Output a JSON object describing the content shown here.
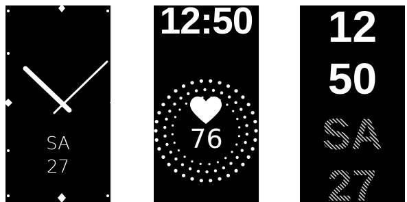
{
  "screens": [
    {
      "style": "analog",
      "day": "SA",
      "date": "27",
      "hour": 12,
      "minute": 50
    },
    {
      "style": "heart-rate",
      "time": "12:50",
      "heart_rate": "76",
      "heart_icon": "heart-icon"
    },
    {
      "style": "stacked-digital",
      "hour": "12",
      "minute": "50",
      "day": "SA",
      "date": "27"
    }
  ],
  "colors": {
    "background": "#000000",
    "foreground": "#ffffff",
    "hatch": "#d9d9d9"
  }
}
